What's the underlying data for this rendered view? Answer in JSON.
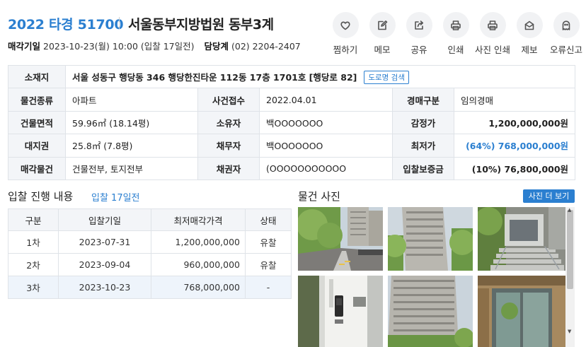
{
  "header": {
    "case_no": "2022 타경 51700",
    "court": "서울동부지방법원 동부3계",
    "sale_date_label": "매각기일",
    "sale_date": "2023-10-23(월) 10:00 (입찰 17일전)",
    "clerk_label": "담당계",
    "clerk_phone": "(02) 2204-2407"
  },
  "actions": [
    {
      "label": "찜하기",
      "icon": "heart-icon"
    },
    {
      "label": "메모",
      "icon": "memo-icon"
    },
    {
      "label": "공유",
      "icon": "share-icon"
    },
    {
      "label": "인쇄",
      "icon": "print-icon"
    },
    {
      "label": "사진 인쇄",
      "icon": "photo-print-icon"
    },
    {
      "label": "제보",
      "icon": "report-icon"
    },
    {
      "label": "오류신고",
      "icon": "ghost-icon"
    }
  ],
  "info": {
    "location_label": "소재지",
    "location": "서울 성동구 행당동 346 행당한진타운 112동 17층 1701호 [행당로 82]",
    "road_search": "도로명 검색",
    "rows": [
      {
        "l1": "물건종류",
        "v1": "아파트",
        "l2": "사건접수",
        "v2": "2022.04.01",
        "l3": "경매구분",
        "v3": "임의경매"
      },
      {
        "l1": "건물면적",
        "v1": "59.96㎡ (18.14평)",
        "l2": "소유자",
        "v2": "백OOOOOOO",
        "l3": "감정가",
        "v3": "1,200,000,000원"
      },
      {
        "l1": "대지권",
        "v1": "25.8㎡ (7.8평)",
        "l2": "채무자",
        "v2": "백OOOOOOO",
        "l3": "최저가",
        "v3": "(64%) 768,000,000원"
      },
      {
        "l1": "매각물건",
        "v1": "건물전부, 토지전부",
        "l2": "채권자",
        "v2": "(OOOOOOOOOOO",
        "l3": "입찰보증금",
        "v3": "(10%) 76,800,000원"
      }
    ]
  },
  "bidding": {
    "title": "입찰 진행 내용",
    "subtitle": "입찰 17일전",
    "headers": [
      "구분",
      "입찰기일",
      "최저매각가격",
      "상태"
    ],
    "rows": [
      {
        "round": "1차",
        "date": "2023-07-31",
        "price": "1,200,000,000",
        "status": "유찰"
      },
      {
        "round": "2차",
        "date": "2023-09-04",
        "price": "960,000,000",
        "status": "유찰"
      },
      {
        "round": "3차",
        "date": "2023-10-23",
        "price": "768,000,000",
        "status": "-"
      }
    ]
  },
  "photos": {
    "title": "물건 사진",
    "more_button": "사진 더 보기"
  },
  "colors": {
    "accent": "#2b7fd0",
    "header_bg": "#f3f5f8",
    "border": "#dfe3e8"
  }
}
